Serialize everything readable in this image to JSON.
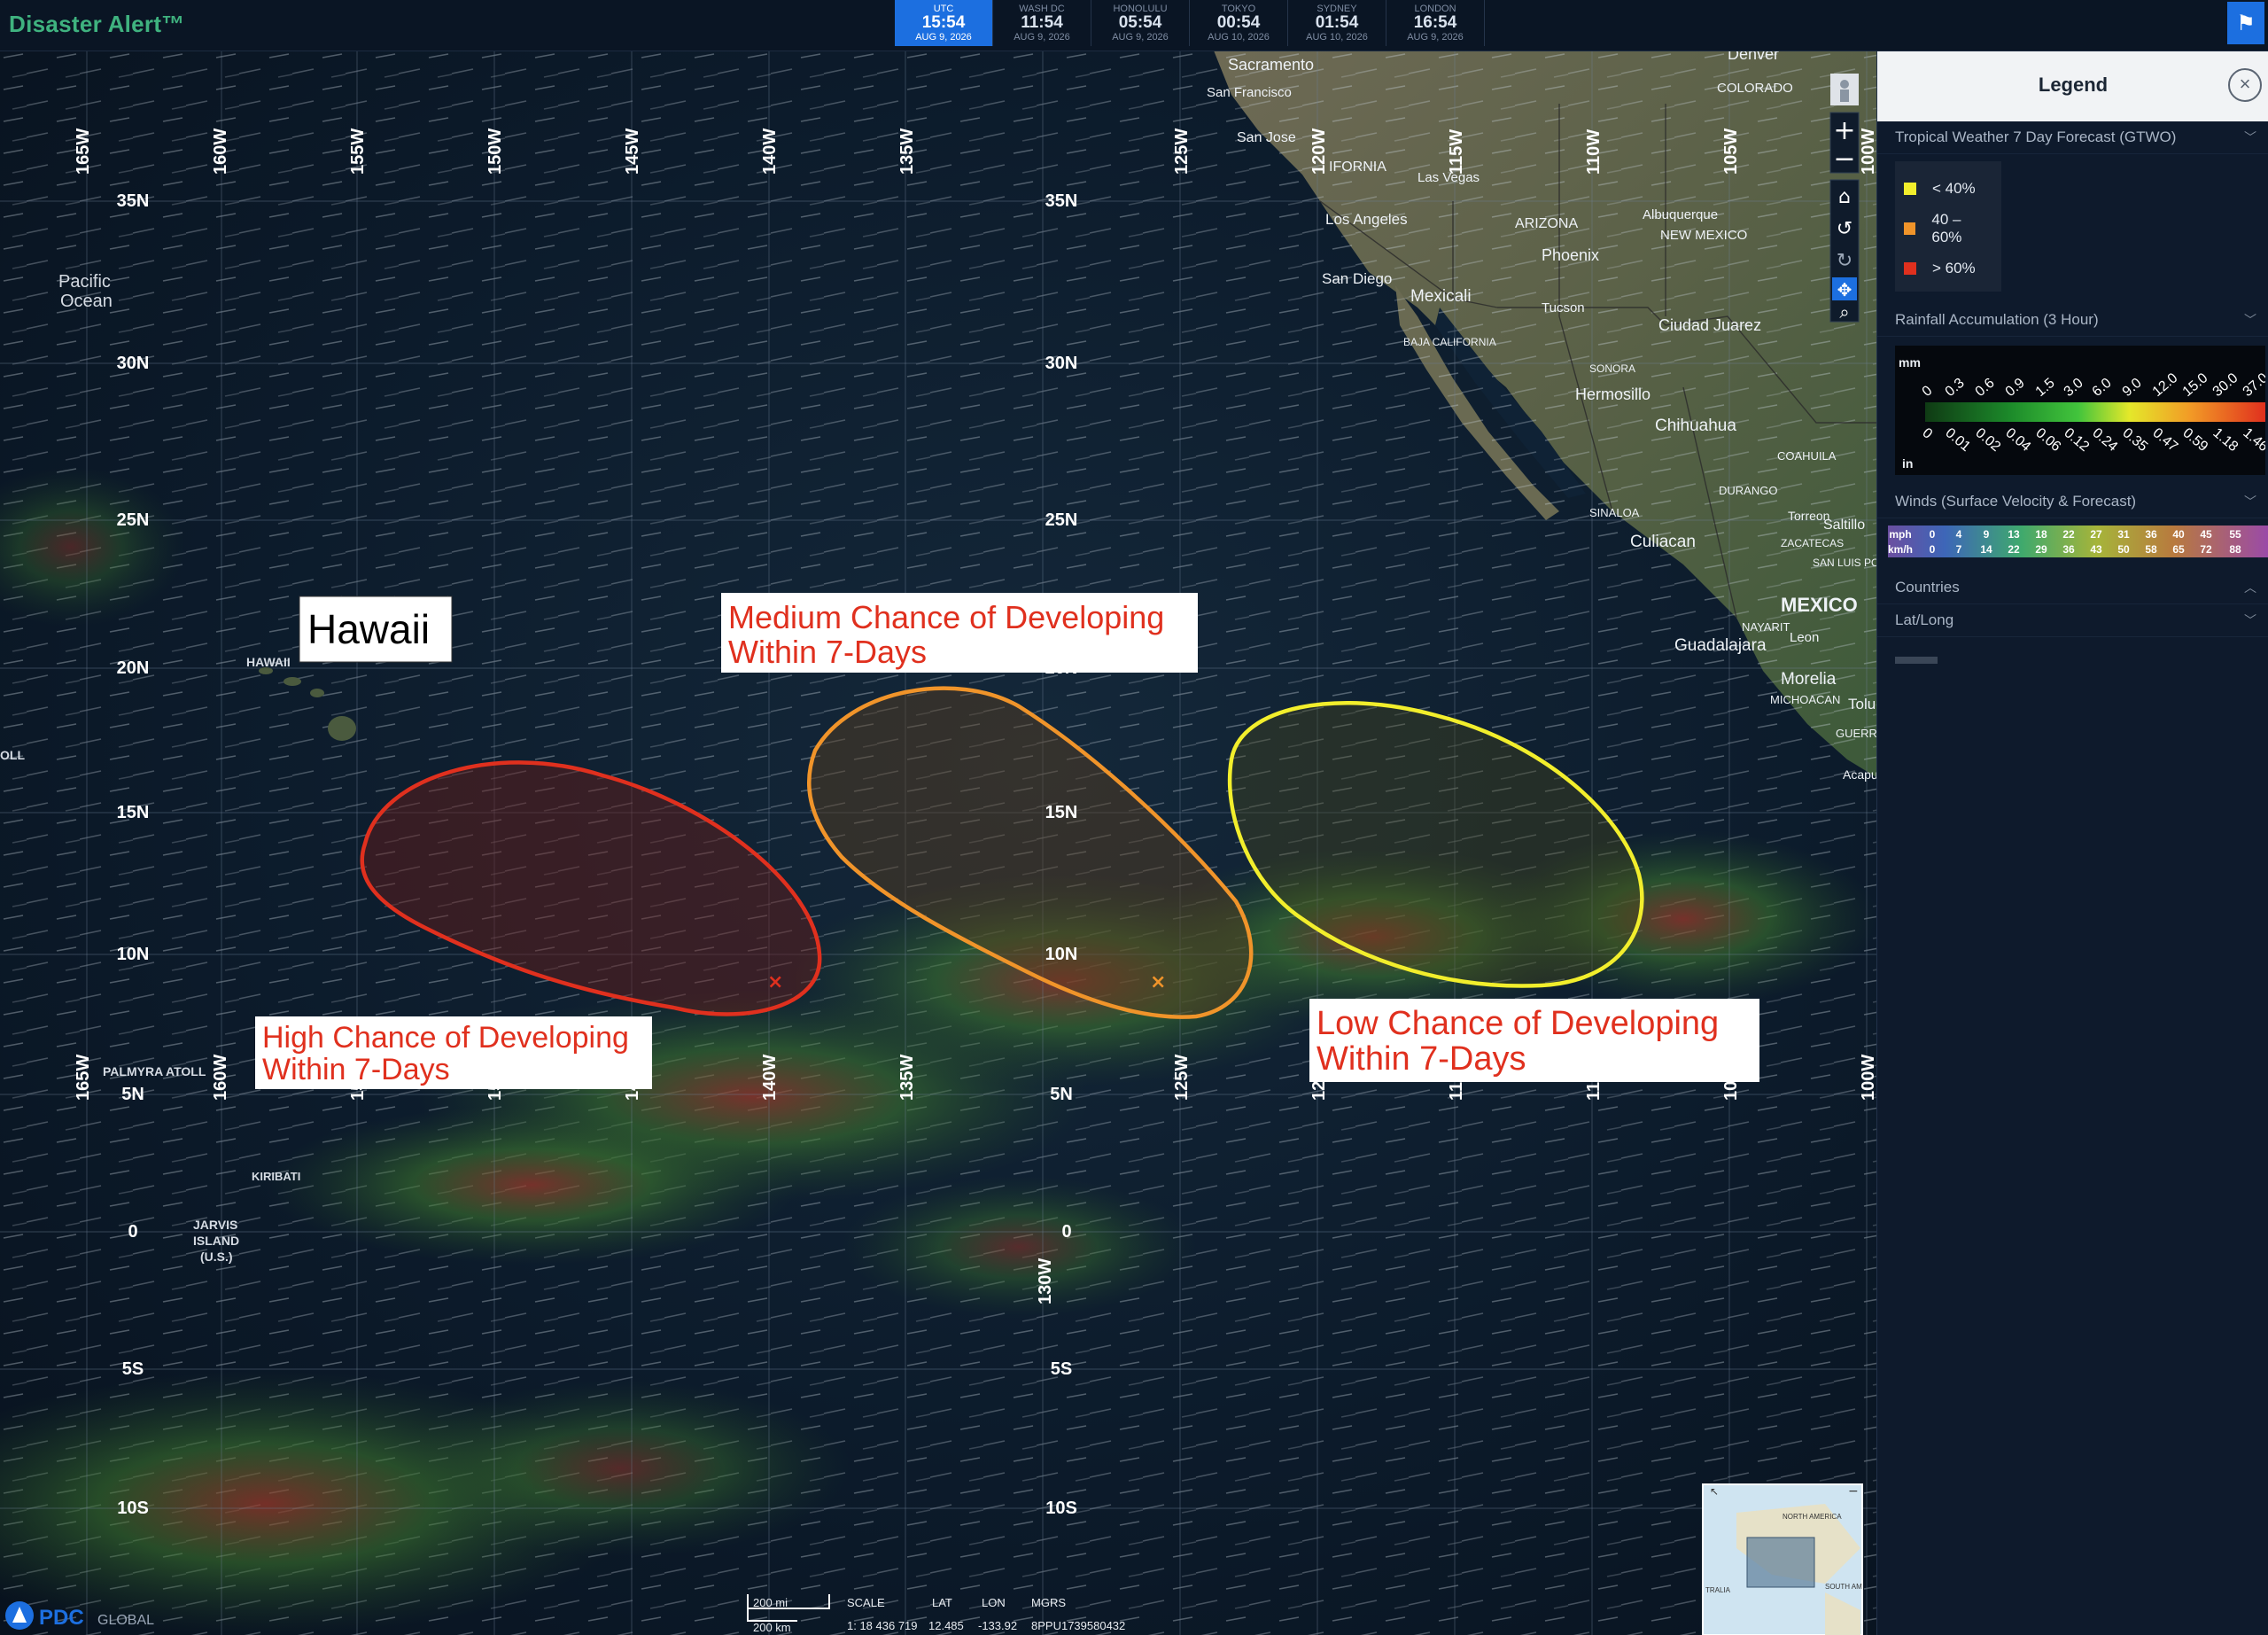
{
  "app": {
    "title": "Disaster Alert™"
  },
  "clocks": [
    {
      "city": "UTC",
      "time": "15:54",
      "date": "AUG 9, 2026",
      "active": true
    },
    {
      "city": "WASH DC",
      "time": "11:54",
      "date": "AUG 9, 2026"
    },
    {
      "city": "HONOLULU",
      "time": "05:54",
      "date": "AUG 9, 2026"
    },
    {
      "city": "TOKYO",
      "time": "00:54",
      "date": "AUG 10, 2026"
    },
    {
      "city": "SYDNEY",
      "time": "01:54",
      "date": "AUG 10, 2026"
    },
    {
      "city": "LONDON",
      "time": "16:54",
      "date": "AUG 9, 2026"
    }
  ],
  "map": {
    "lon_labels": [
      "165W",
      "160W",
      "155W",
      "150W",
      "145W",
      "140W",
      "135W",
      "130W",
      "125W",
      "120W",
      "115W",
      "110W",
      "105W",
      "100W"
    ],
    "lat_labels": [
      "35N",
      "30N",
      "25N",
      "20N",
      "15N",
      "10N",
      "5N",
      "0",
      "5S",
      "10S"
    ],
    "place_labels": {
      "pacific": [
        "Pacific",
        "Ocean"
      ],
      "hawaii_small": "HAWAII",
      "palmyra": "PALMYRA ATOLL",
      "kiribati": "KIRIBATI",
      "jarvis": [
        "JARVIS",
        "ISLAND",
        "(U.S.)"
      ],
      "ol": "OLL",
      "cities": [
        "Sacramento",
        "San Francisco",
        "San Jose",
        "Los Angeles",
        "San Diego",
        "Mexicali",
        "Las Vegas",
        "Phoenix",
        "Tucson",
        "Albuquerque",
        "Ciudad Juarez",
        "Hermosillo",
        "Chihuahua",
        "Culiacan",
        "Guadalajara",
        "Morelia",
        "Torreon",
        "Saltillo",
        "Acapulco",
        "Denver",
        "DURANGO",
        "SINALOA",
        "COAHUILA",
        "NAYARIT",
        "MICHOACAN",
        "GUERR",
        "ARIZONA",
        "NEW MEXICO",
        "COLORADO",
        "IFORNIA",
        "MEXICO",
        "BAJA CALIFORNIA",
        "SONORA",
        "ZACATECAS",
        "SAN LUIS POTOSI",
        "Leon",
        "Toluca"
      ]
    },
    "annotations": {
      "hawaii": "Hawaii",
      "medium": [
        "Medium Chance of Developing",
        "Within 7-Days"
      ],
      "high": [
        "High Chance of Developing",
        "Within 7-Days"
      ],
      "low": [
        "Low Chance of Developing",
        "Within 7-Days"
      ]
    },
    "outlook_colors": {
      "high": "#e0301e",
      "medium": "#f0942a",
      "low": "#f2ee2c"
    },
    "tools": [
      "person-icon",
      "zoom-in-icon",
      "zoom-out-icon",
      "home-icon",
      "rotate-left-icon",
      "rotate-right-icon",
      "pan-icon",
      "magnify-icon"
    ],
    "scale": {
      "mi": "200 mi",
      "km": "200 km",
      "scale_label": "SCALE",
      "scale_value": "1: 18 436 719",
      "lat_label": "LAT",
      "lat_value": "12.485",
      "lon_label": "LON",
      "lon_value": "-133.92",
      "mgrs_label": "MGRS",
      "mgrs_value": "8PPU1739580432"
    },
    "footer_logo": {
      "pdc": "PDC",
      "global": "GLOBAL"
    },
    "minimap": {
      "north_america": "NORTH AMERICA",
      "south_america": "SOUTH AM",
      "australia": "TRALIA"
    }
  },
  "legend": {
    "title": "Legend",
    "gtwo": {
      "title": "Tropical Weather 7 Day Forecast (GTWO)",
      "items": [
        {
          "label": "< 40%",
          "color": "#f2ee2c"
        },
        {
          "label": "40 – 60%",
          "color": "#f0942a"
        },
        {
          "label": "> 60%",
          "color": "#e0301e"
        }
      ]
    },
    "rainfall": {
      "title": "Rainfall Accumulation (3 Hour)",
      "mm_unit": "mm",
      "in_unit": "in",
      "mm_ticks": [
        "0",
        "0.3",
        "0.6",
        "0.9",
        "1.5",
        "3.0",
        "6.0",
        "9.0",
        "12.0",
        "15.0",
        "30.0",
        "37.0"
      ],
      "in_ticks": [
        "0",
        "0.01",
        "0.02",
        "0.04",
        "0.06",
        "0.12",
        "0.24",
        "0.35",
        "0.47",
        "0.59",
        "1.18",
        "1.46"
      ]
    },
    "winds": {
      "title": "Winds (Surface Velocity & Forecast)",
      "mph_label": "mph",
      "kmh_label": "km/h",
      "mph": [
        "0",
        "4",
        "9",
        "13",
        "18",
        "22",
        "27",
        "31",
        "36",
        "40",
        "45",
        "55"
      ],
      "kmh": [
        "0",
        "7",
        "14",
        "22",
        "29",
        "36",
        "43",
        "50",
        "58",
        "65",
        "72",
        "88"
      ]
    },
    "countries": "Countries",
    "latlong": "Lat/Long"
  }
}
